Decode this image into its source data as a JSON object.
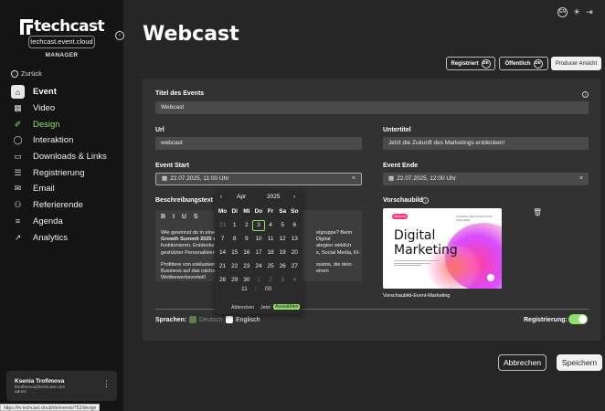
{
  "brand": {
    "name": "techcast",
    "domain": "techcast.event.cloud",
    "role": "MANAGER"
  },
  "sidebar": {
    "back_label": "Zurück",
    "items": [
      {
        "label": "Event",
        "icon": "home-icon"
      },
      {
        "label": "Video",
        "icon": "calendar-icon"
      },
      {
        "label": "Design",
        "icon": "brush-icon"
      },
      {
        "label": "Interaktion",
        "icon": "chat-icon"
      },
      {
        "label": "Downloads & Links",
        "icon": "download-icon"
      },
      {
        "label": "Registrierung",
        "icon": "register-icon"
      },
      {
        "label": "Email",
        "icon": "mail-icon"
      },
      {
        "label": "Referierende",
        "icon": "people-icon"
      },
      {
        "label": "Agenda",
        "icon": "list-icon"
      },
      {
        "label": "Analytics",
        "icon": "chart-icon"
      }
    ],
    "user": {
      "name": "Ksenia Trofimova",
      "email": "ktrofimova@techcast.com",
      "role": "admin"
    }
  },
  "status_url": "https://m.techcast.cloud/de/events/752/design",
  "header": {
    "title": "Webcast",
    "lang": "EN"
  },
  "toolbar": {
    "registered_label": "Registriert",
    "public_label": "Öffentlich",
    "lang_badge": "DE",
    "producer_label": "Producer Ansicht"
  },
  "form": {
    "title_label": "Titel des Events",
    "title_value": "Webcast",
    "url_label": "Url",
    "url_value": "webcast",
    "subtitle_label": "Untertitel",
    "subtitle_value": "Jetzt die Zukunft des Marketings entdecken!",
    "start_label": "Event Start",
    "start_value": "22.07.2025, 11:00 Uhr",
    "end_label": "Event Ende",
    "end_value": "22.07.2025, 12:00 Uhr",
    "description_label": "Beschreibungstext",
    "editor_toolbar": "B I U S",
    "desc_line1": "Wie gewinnst du in einer",
    "desc_line2": "Growth Summit 2025 erf",
    "desc_line3": "funktionieren. Entdecke i",
    "desc_line4": "gestützter Personalisierun",
    "desc_line5": "Profitiere von exklusiven",
    "desc_line6": "Business auf das nächste",
    "desc_line7": "Wettbewerbsvorteil!",
    "desc_r1": "elgruppe? Beim Digital",
    "desc_r2": "ategien wirklich",
    "desc_r3": "s, Social Media, KI-",
    "desc_r4": "ssions, die dein",
    "desc_r5": "einen",
    "preview_label": "Vorschaubild",
    "preview_caption": "Vorschaubild-Event-Marketing",
    "preview_big_text": "Digital Marketing",
    "preview_badge": "Webcast",
    "preview_nav": "AGENDA  REGISTRATION  SPEAKER",
    "languages_label": "Sprachen:",
    "lang_de": "Deutsch",
    "lang_en": "Englisch",
    "registration_label": "Registrierung:"
  },
  "actions": {
    "cancel_label": "Abbrechen",
    "save_label": "Speichern"
  },
  "datepicker": {
    "month": "Apr",
    "year": "2025",
    "weekdays": [
      "Mo",
      "Di",
      "Mi",
      "Do",
      "Fr",
      "Sa",
      "So"
    ],
    "weeks": [
      [
        "31",
        "1",
        "2",
        "3",
        "4",
        "5",
        "6"
      ],
      [
        "7",
        "8",
        "9",
        "10",
        "11",
        "12",
        "13"
      ],
      [
        "14",
        "15",
        "16",
        "17",
        "18",
        "19",
        "20"
      ],
      [
        "21",
        "22",
        "23",
        "24",
        "25",
        "26",
        "27"
      ],
      [
        "28",
        "29",
        "30",
        "1",
        "2",
        "3",
        "4"
      ]
    ],
    "selected": "3",
    "hour": "11",
    "minute": "00",
    "time_sep": ":",
    "cancel_label": "Abbrechen",
    "now_label": "Jetzt",
    "choose_label": "Auswählen"
  }
}
